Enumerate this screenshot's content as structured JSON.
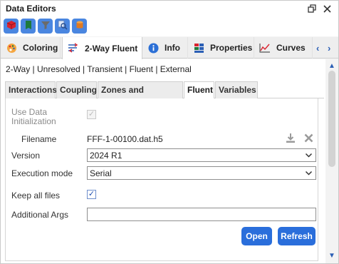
{
  "window": {
    "title": "Data Editors",
    "restore_icon": "restore-icon",
    "close_icon": "close-icon"
  },
  "toolbar": {
    "tools": [
      {
        "name": "cube-tool",
        "icon": "red-cube-icon",
        "color": "#d9232f"
      },
      {
        "name": "book-tool",
        "icon": "green-book-icon",
        "color": "#1e7a3c"
      },
      {
        "name": "filter-tool",
        "icon": "funnel-icon",
        "color": "#6b6b6b"
      },
      {
        "name": "find-tool",
        "icon": "magnifier-icon",
        "color": "#5a7fbf"
      },
      {
        "name": "cylinder-tool",
        "icon": "orange-cylinder-icon",
        "color": "#e07a22"
      }
    ]
  },
  "tabs": [
    {
      "label": "Coloring",
      "icon": "palette-icon",
      "active": false
    },
    {
      "label": "2-Way Fluent",
      "icon": "coupling-icon",
      "active": true
    },
    {
      "label": "Info",
      "icon": "info-icon",
      "active": false
    },
    {
      "label": "Properties",
      "icon": "properties-icon",
      "active": false
    },
    {
      "label": "Curves",
      "icon": "curve-chart-icon",
      "active": false
    }
  ],
  "status_line": "2-Way | Unresolved | Transient | Fluent | External",
  "subtabs": [
    {
      "label": "Interactions",
      "active": false
    },
    {
      "label": "Coupling",
      "active": false
    },
    {
      "label": "Zones and Interfaces",
      "active": false
    },
    {
      "label": "Fluent",
      "active": true
    },
    {
      "label": "Variables",
      "active": false
    }
  ],
  "form": {
    "use_data_init_label_1": "Use Data",
    "use_data_init_label_2": "Initialization",
    "use_data_init_checked": true,
    "use_data_init_enabled": false,
    "filename_label": "Filename",
    "filename_value": "FFF-1-00100.dat.h5",
    "version_label": "Version",
    "version_value": "2024 R1",
    "execution_label": "Execution mode",
    "execution_value": "Serial",
    "keep_files_label": "Keep all files",
    "keep_files_checked": true,
    "args_label": "Additional Args",
    "args_value": ""
  },
  "buttons": {
    "open": "Open",
    "refresh": "Refresh"
  },
  "colors": {
    "accent": "#2a6edb",
    "tab_icon_blue": "#2b5fb5"
  }
}
